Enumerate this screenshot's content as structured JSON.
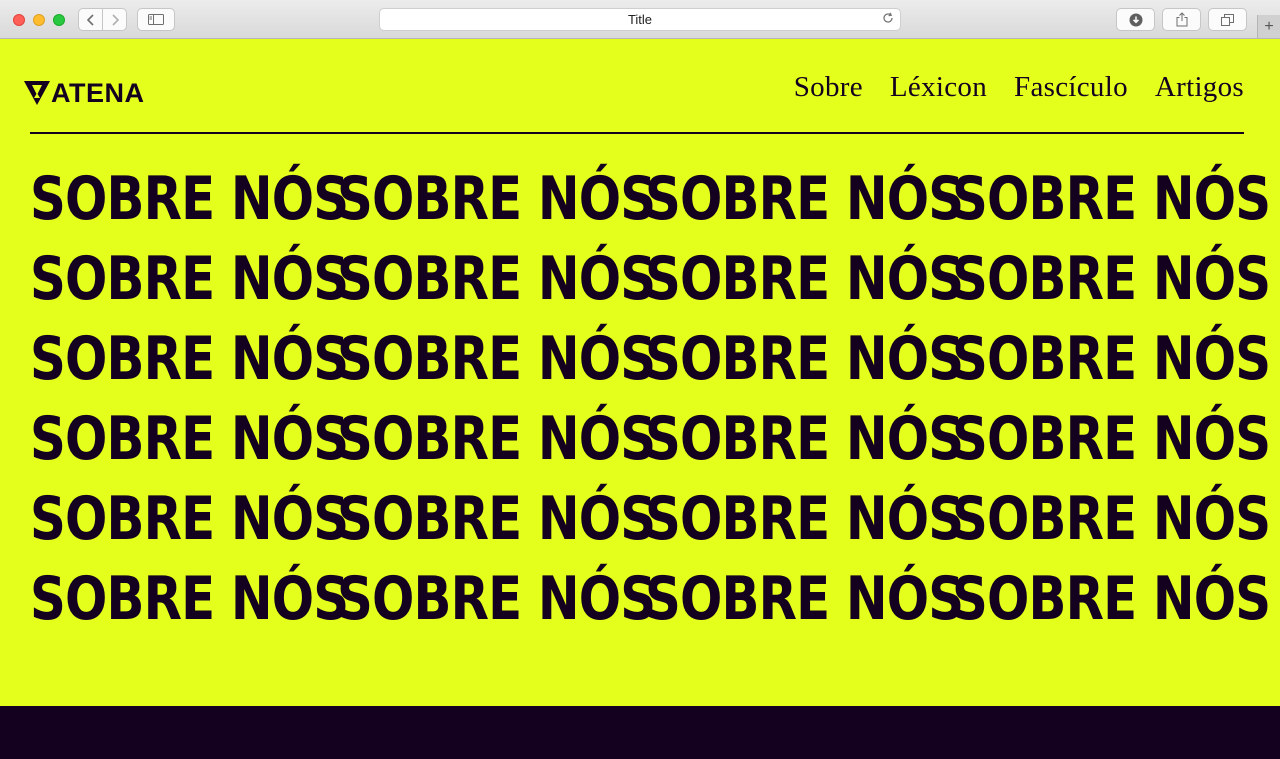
{
  "browser": {
    "tab_title": "Title",
    "reload_icon": "reload-icon",
    "new_tab_label": "+"
  },
  "site": {
    "logo_text": "ATENA",
    "nav": [
      {
        "label": "Sobre"
      },
      {
        "label": "Léxicon"
      },
      {
        "label": "Fascículo"
      },
      {
        "label": "Artigos"
      }
    ],
    "hero_word": "SOBRE NÓS"
  },
  "colors": {
    "background": "#e4ff1c",
    "ink": "#14001f"
  }
}
